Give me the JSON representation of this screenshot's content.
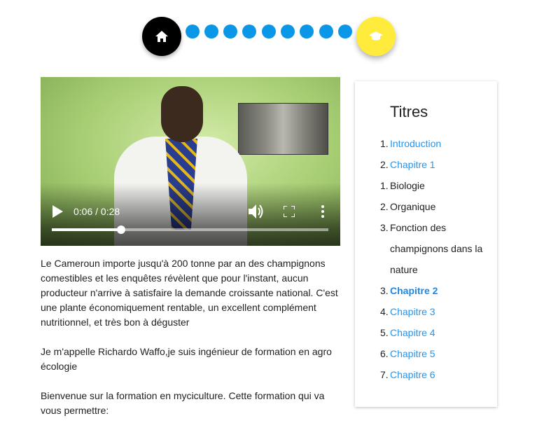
{
  "progress": {
    "home_icon": "home-icon",
    "grad_icon": "graduation-cap-icon",
    "step_count": 9,
    "accent": "#0a97e8",
    "grad_color": "#ffeb3b"
  },
  "video": {
    "time": "0:06 / 0:28",
    "progress": 0.25
  },
  "content": {
    "p1": "Le Cameroun importe jusqu'à 200 tonne par an des champignons comestibles et les enquêtes révèlent que pour l'instant, aucun producteur n'arrive à satisfaire la demande croissante national. C'est une plante économiquement rentable, un excellent complément nutritionnel, et très bon à déguster",
    "p2": "Je m'appelle Richardo Waffo,je suis ingénieur de formation en agro écologie",
    "p3": "Bienvenue sur la formation en myciculture. Cette formation qui va vous permettre:"
  },
  "toc": {
    "title": "Titres",
    "items": [
      {
        "num": "1.",
        "label": "Introduction"
      },
      {
        "num": "2.",
        "label": "Chapitre 1"
      },
      {
        "num": "1.",
        "label": "Biologie"
      },
      {
        "num": "2.",
        "label": "Organique"
      },
      {
        "num": "3.",
        "label": "Fonction des champignons dans la nature"
      },
      {
        "num": "3.",
        "label": "Chapitre 2"
      },
      {
        "num": "4.",
        "label": "Chapitre 3"
      },
      {
        "num": "5.",
        "label": "Chapitre 4"
      },
      {
        "num": "6.",
        "label": "Chapitre 5"
      },
      {
        "num": "7.",
        "label": "Chapitre 6"
      }
    ]
  }
}
